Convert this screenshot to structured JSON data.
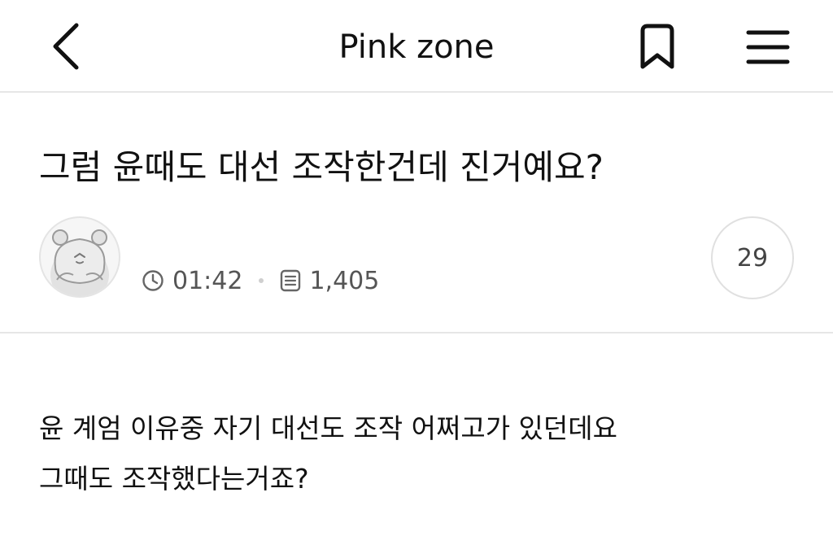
{
  "header": {
    "title": "Pink zone",
    "back_icon": "chevron-left-icon",
    "bookmark_icon": "bookmark-icon",
    "menu_icon": "hamburger-menu-icon"
  },
  "post": {
    "title": "그럼 윤때도 대선 조작한건데 진거예요?",
    "author": {
      "name": "",
      "avatar_icon": "hamster-avatar-icon"
    },
    "time": "01:42",
    "time_icon": "clock-icon",
    "views": "1,405",
    "views_icon": "document-list-icon",
    "comment_count": "29",
    "body_lines": [
      "윤 계엄 이유중 자기 대선도 조작 어쩌고가 있던데요",
      "그때도 조작했다는거죠?"
    ]
  },
  "colors": {
    "divider": "#e6e6e6",
    "meta_text": "#555555",
    "text": "#111111"
  }
}
